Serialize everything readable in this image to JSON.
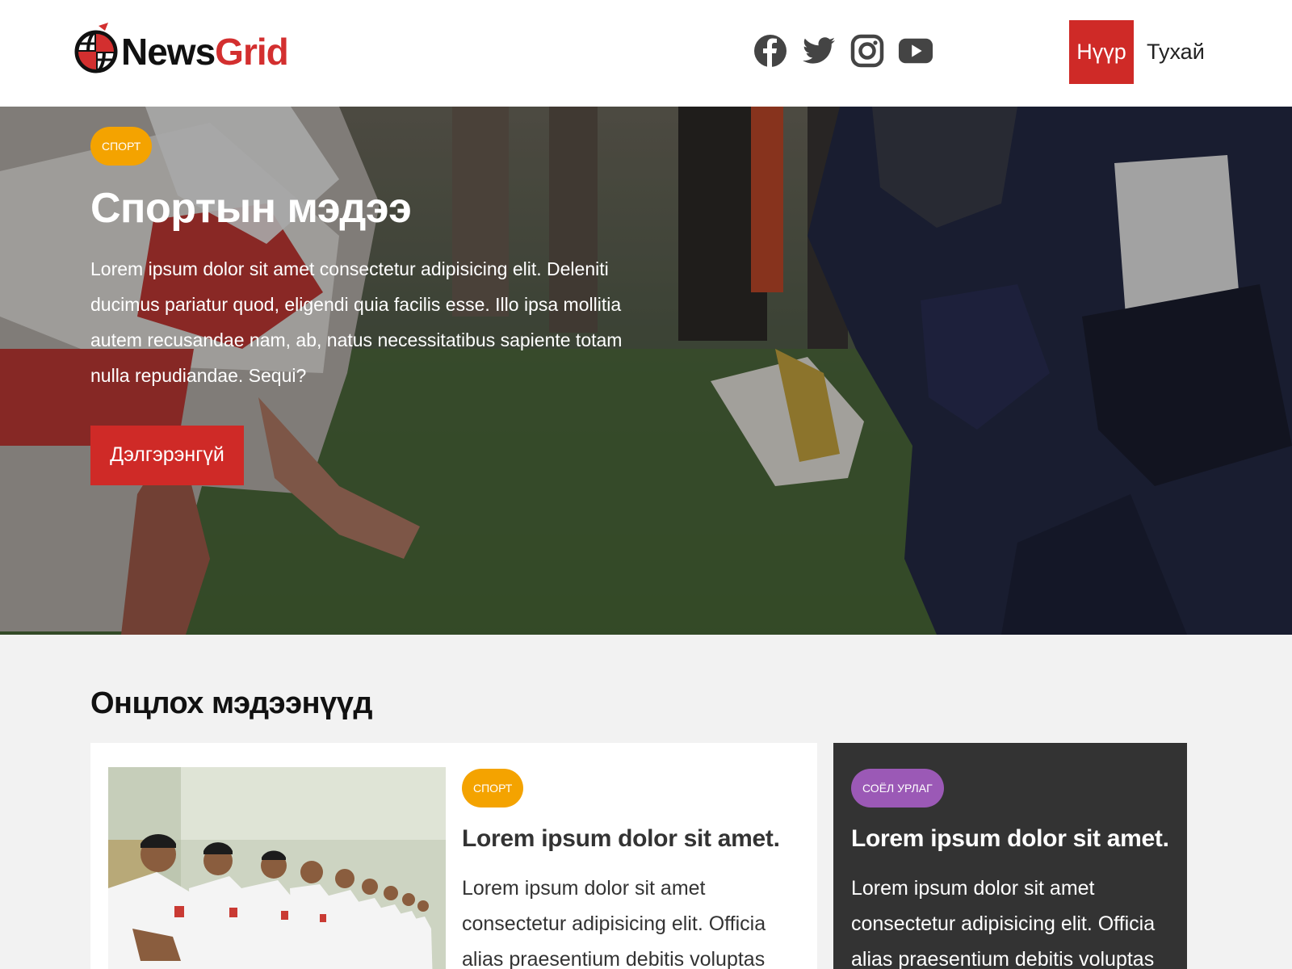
{
  "brand": {
    "name_part1": "News",
    "name_part2": "Grid",
    "accent_color": "#d32f2f"
  },
  "social": [
    "facebook-icon",
    "twitter-icon",
    "instagram-icon",
    "youtube-icon"
  ],
  "nav": {
    "home": "Нүүр",
    "about": "Тухай"
  },
  "hero": {
    "badge": "СПОРТ",
    "title": "Спортын мэдээ",
    "text": "Lorem ipsum dolor sit amet consectetur adipisicing elit. Deleniti ducimus pariatur quod, eligendi quia facilis esse. Illo ipsa mollitia autem recusandae nam, ab, natus necessitatibus sapiente totam nulla repudiandae. Sequi?",
    "button": "Дэлгэрэнгүй"
  },
  "featured": {
    "title": "Онцлох мэдээнүүд",
    "main_card": {
      "badge": "СПОРТ",
      "title": "Lorem ipsum dolor sit amet.",
      "text": "Lorem ipsum dolor sit amet consectetur adipisicing elit. Officia alias praesentium debitis voluptas amet, dolores et voluptatum"
    },
    "side_card": {
      "badge": "СОЁЛ УРЛАГ",
      "title": "Lorem ipsum dolor sit amet.",
      "text": "Lorem ipsum dolor sit amet consectetur adipisicing elit. Officia alias praesentium debitis voluptas amet, dolores et"
    }
  }
}
